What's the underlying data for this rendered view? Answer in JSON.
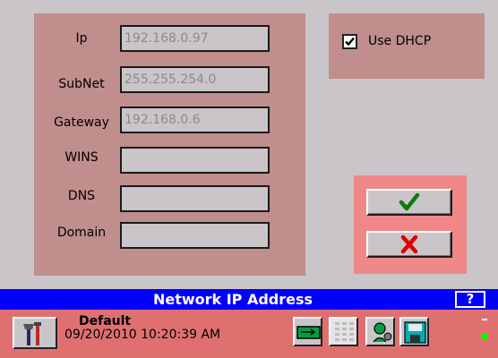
{
  "network_form": {
    "fields": [
      {
        "label": "Ip",
        "value": "192.168.0.97"
      },
      {
        "label": "SubNet",
        "value": "255.255.254.0"
      },
      {
        "label": "Gateway",
        "value": "192.168.0.6"
      },
      {
        "label": "WINS",
        "value": ""
      },
      {
        "label": "DNS",
        "value": ""
      },
      {
        "label": "Domain",
        "value": ""
      }
    ]
  },
  "dhcp": {
    "label": "Use DHCP",
    "checked": true
  },
  "actions": {
    "ok_icon": "checkmark-icon",
    "cancel_icon": "x-icon",
    "ok_color": "#0b7a0b",
    "cancel_color": "#e00000"
  },
  "title_bar": {
    "title": "Network IP Address",
    "help_label": "?",
    "color": "#0000fe"
  },
  "status_bar": {
    "profile": "Default",
    "datetime": "09/20/2010 10:20:39 AM",
    "icons": [
      "tools-icon",
      "network-icon",
      "keypad-icon",
      "user-settings-icon",
      "save-icon"
    ]
  }
}
